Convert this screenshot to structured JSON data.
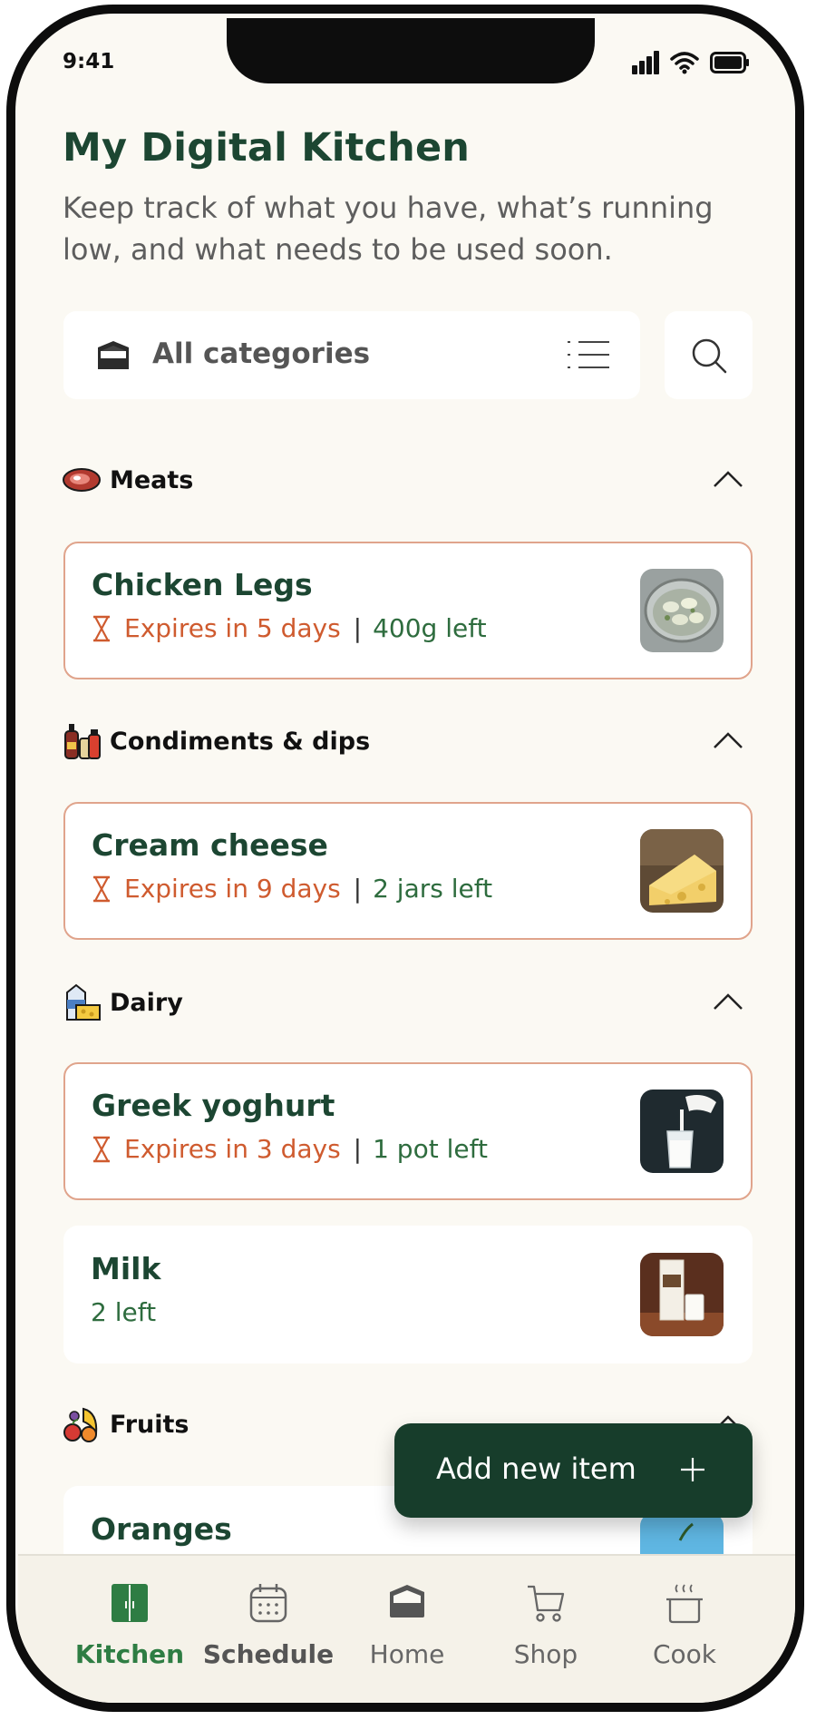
{
  "status_bar": {
    "time": "9:41"
  },
  "header": {
    "title": "My Digital Kitchen",
    "subtitle": "Keep track of what you have, what’s running low, and what needs to be used soon."
  },
  "filter": {
    "category_label": "All categories"
  },
  "sections": [
    {
      "label": "Meats",
      "icon": "steak-icon",
      "items": [
        {
          "name": "Chicken Legs",
          "expiry": "Expires in 5 days",
          "quantity": "400g left",
          "thumb": "chicken-legs-image"
        }
      ]
    },
    {
      "label": "Condiments & dips",
      "icon": "condiments-icon",
      "items": [
        {
          "name": "Cream cheese",
          "expiry": "Expires in 9 days",
          "quantity": "2 jars left",
          "thumb": "cheese-image"
        }
      ]
    },
    {
      "label": "Dairy",
      "icon": "dairy-icon",
      "items": [
        {
          "name": "Greek yoghurt",
          "expiry": "Expires in 3 days",
          "quantity": "1 pot left",
          "thumb": "milk-pour-image"
        },
        {
          "name": "Milk",
          "quantity": "2 left",
          "thumb": "milk-carton-image"
        }
      ]
    },
    {
      "label": "Fruits",
      "icon": "fruits-icon",
      "items": [
        {
          "name": "Oranges",
          "thumb": "oranges-image"
        }
      ]
    }
  ],
  "fab": {
    "label": "Add new item",
    "icon": "plus-icon"
  },
  "bottom_nav": [
    {
      "label": "Kitchen",
      "icon": "fridge-icon",
      "active": true
    },
    {
      "label": "Schedule",
      "icon": "calendar-icon"
    },
    {
      "label": "Home",
      "icon": "home-box-icon"
    },
    {
      "label": "Shop",
      "icon": "cart-icon"
    },
    {
      "label": "Cook",
      "icon": "pot-icon"
    }
  ],
  "colors": {
    "brand_green": "#1c4632",
    "warning": "#cf5b2f",
    "quantity_green": "#2e6c3e",
    "background": "#fbf9f3"
  }
}
